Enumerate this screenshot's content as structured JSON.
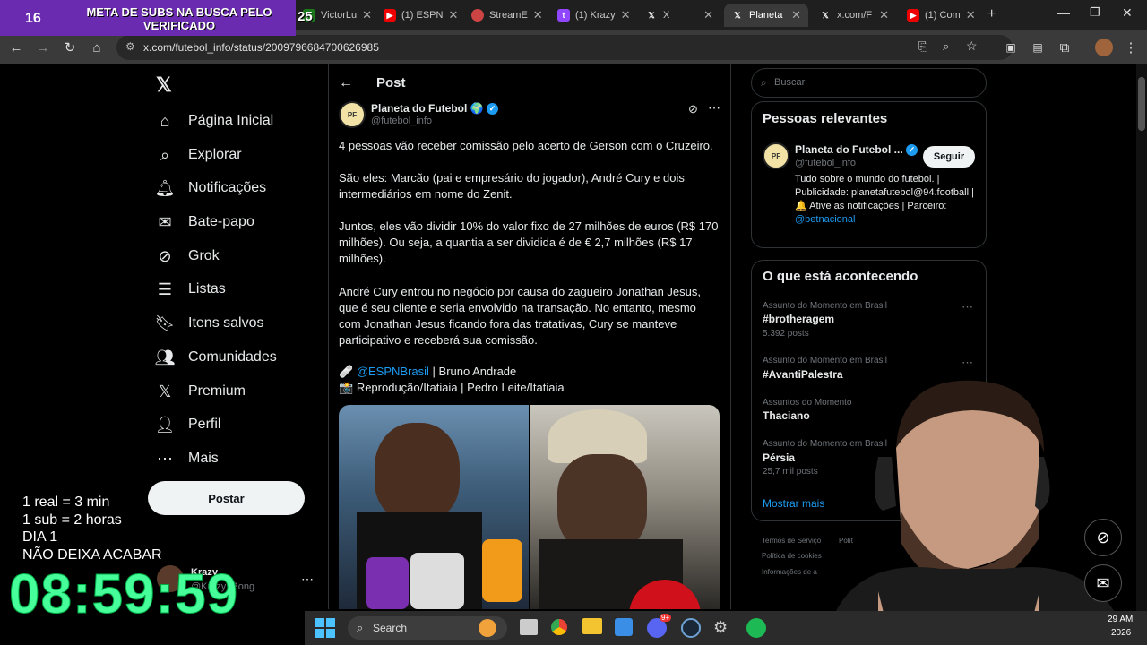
{
  "overlay": {
    "banner_count": "16",
    "banner_text": "META DE SUBS NA BUSCA PELO VERIFICADO",
    "badge": "25",
    "lines": [
      "1 real = 3 min",
      "1 sub = 2 horas",
      "DIA 1",
      "NÃO DEIXA ACABAR"
    ],
    "timer": "08:59:59"
  },
  "browser": {
    "tabs": [
      {
        "label": "VictorLu",
        "icon": "k-icon"
      },
      {
        "label": "(1) ESPN",
        "icon": "youtube-icon"
      },
      {
        "label": "StreamE",
        "icon": "stream-icon"
      },
      {
        "label": "(1) Krazy",
        "icon": "twitch-icon"
      },
      {
        "label": "X",
        "icon": "x-icon"
      },
      {
        "label": "Planeta",
        "icon": "x-icon"
      },
      {
        "label": "x.com/F",
        "icon": "x-icon"
      },
      {
        "label": "(1) Com",
        "icon": "youtube-icon"
      }
    ],
    "url": "x.com/futebol_info/status/2009796684700626985"
  },
  "sidebar": {
    "items": [
      {
        "label": "Página Inicial",
        "icon": "home-icon"
      },
      {
        "label": "Explorar",
        "icon": "search-icon"
      },
      {
        "label": "Notificações",
        "icon": "bell-icon"
      },
      {
        "label": "Bate-papo",
        "icon": "mail-icon"
      },
      {
        "label": "Grok",
        "icon": "grok-icon"
      },
      {
        "label": "Listas",
        "icon": "list-icon"
      },
      {
        "label": "Itens salvos",
        "icon": "bookmark-icon"
      },
      {
        "label": "Comunidades",
        "icon": "people-icon"
      },
      {
        "label": "Premium",
        "icon": "x-icon"
      },
      {
        "label": "Perfil",
        "icon": "person-icon"
      },
      {
        "label": "Mais",
        "icon": "more-icon"
      }
    ],
    "post_label": "Postar",
    "account": {
      "name": "Krazy",
      "handle": "@Krazy_Bong"
    }
  },
  "post": {
    "header": "Post",
    "author": "Planeta do Futebol",
    "author_emoji": "🌍",
    "handle": "@futebol_info",
    "paragraphs": [
      "4 pessoas vão receber comissão pelo acerto de Gerson com o Cruzeiro.",
      "São eles: Marcão (pai e empresário do jogador), André Cury e dois intermediários em nome do Zenit.",
      "Juntos, eles vão dividir 10% do valor fixo de 27 milhões de euros (R$ 170 milhões). Ou seja, a quantia a ser dividida é de € 2,7 milhões (R$ 17 milhões).",
      "André Cury entrou no negócio por causa do zagueiro Jonathan Jesus, que é seu cliente e seria envolvido na transação. No entanto, mesmo com Jonathan Jesus ficando fora das tratativas, Cury se manteve participativo e receberá sua comissão."
    ],
    "credit1_emoji": "🩹",
    "credit1_link": "@ESPNBrasil",
    "credit1_rest": " | Bruno Andrade",
    "credit2_emoji": "📸",
    "credit2": "Reprodução/Itatiaia | Pedro Leite/Itatiaia"
  },
  "right": {
    "search_placeholder": "Buscar",
    "relevant_title": "Pessoas relevantes",
    "relevant_name": "Planeta do Futebol ...",
    "relevant_handle": "@futebol_info",
    "follow_label": "Seguir",
    "bio": "Tudo sobre o mundo do futebol. | Publicidade: planetafutebol@94.football | 🔔 Ative as notificações | Parceiro:",
    "bio_link": "@betnacional",
    "trends_title": "O que está acontecendo",
    "trends": [
      {
        "category": "Assunto do Momento em Brasil",
        "name": "#brotheragem",
        "count": "5.392 posts"
      },
      {
        "category": "Assunto do Momento em Brasil",
        "name": "#AvantiPalestra",
        "count": ""
      },
      {
        "category": "Assuntos do Momento",
        "name": "Thaciano",
        "count": ""
      },
      {
        "category": "Assunto do Momento em Brasil",
        "name": "Pérsia",
        "count": "25,7 mil posts"
      }
    ],
    "show_more": "Mostrar mais",
    "footer": [
      "Termos de Serviço",
      "Polít",
      "Política de cookies",
      "Informações de a"
    ]
  },
  "taskbar": {
    "search_label": "Search",
    "time": "29 AM",
    "date": "2026",
    "discord_badge": "9+"
  },
  "colors": {
    "accent": "#1d9bf0",
    "timer": "#46ff9b",
    "banner": "#6a2bb0"
  }
}
